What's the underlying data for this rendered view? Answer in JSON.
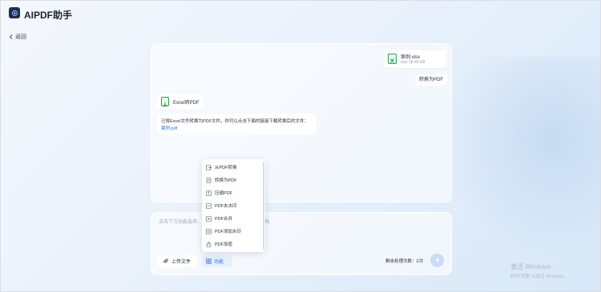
{
  "app": {
    "title": "AIPDF助手"
  },
  "nav": {
    "back_label": "返回"
  },
  "chat": {
    "file_name": "案例.xlsx",
    "file_size": "xlsx 18.45 KB",
    "user_message": "转换为PDF",
    "tool_label": "Excel转PDF",
    "bot_message": "已将Excel文件转换为PDF文件，你可以点击下面的链接下载转换后的文件：",
    "bot_link": "案例.pdf"
  },
  "input": {
    "placeholder": "点击下方功能选项，选择一个功能即可快速处理文档",
    "upload_label": "上传文件",
    "func_label": "功能",
    "remaining_label": "剩余处理次数：",
    "remaining_count": "2次"
  },
  "menu": {
    "items": [
      {
        "label": "从PDF转换",
        "icon": "convert-from-pdf-icon"
      },
      {
        "label": "转换为PDF",
        "icon": "convert-to-pdf-icon"
      },
      {
        "label": "压缩PDF",
        "icon": "compress-pdf-icon"
      },
      {
        "label": "PDF去水印",
        "icon": "remove-watermark-icon"
      },
      {
        "label": "PDF合并",
        "icon": "merge-pdf-icon"
      },
      {
        "label": "PDF添加水印",
        "icon": "add-watermark-icon"
      },
      {
        "label": "PDF加密",
        "icon": "encrypt-pdf-icon"
      }
    ]
  },
  "watermark": {
    "line1": "激活 Windows",
    "line2": "转到\"设置\"以激活 Windows。"
  },
  "colors": {
    "accent": "#2f6fe0",
    "excel_green": "#2f9a4b",
    "logo_bg": "#1f2d4d"
  }
}
